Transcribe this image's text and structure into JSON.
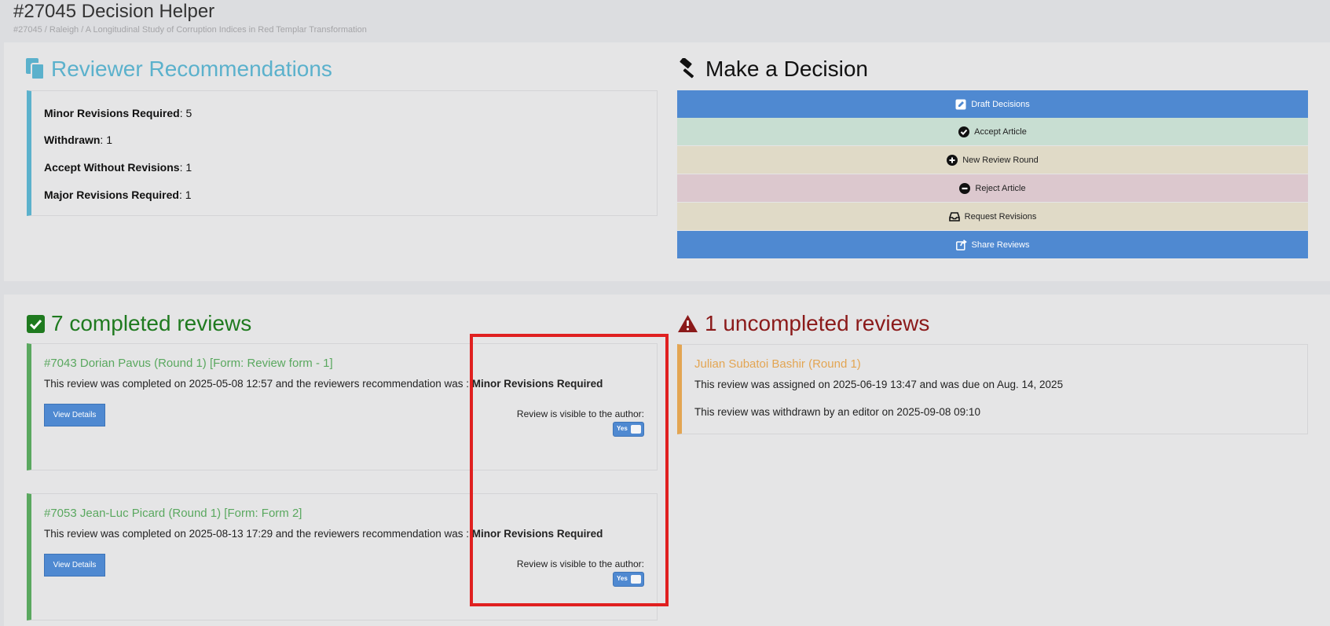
{
  "header": {
    "title": "#27045 Decision Helper",
    "breadcrumb": "#27045 / Raleigh / A Longitudinal Study of Corruption Indices in Red Templar Transformation"
  },
  "recommendations": {
    "title": "Reviewer Recommendations",
    "items": [
      {
        "label": "Minor Revisions Required",
        "value": ": 5"
      },
      {
        "label": "Withdrawn",
        "value": ": 1"
      },
      {
        "label": "Accept Without Revisions",
        "value": ": 1"
      },
      {
        "label": "Major Revisions Required",
        "value": ": 1"
      }
    ]
  },
  "decision": {
    "title": "Make a Decision",
    "buttons": [
      {
        "label": "Draft Decisions",
        "icon": "edit-icon"
      },
      {
        "label": "Accept Article",
        "icon": "check-circle-icon"
      },
      {
        "label": "New Review Round",
        "icon": "plus-circle-icon"
      },
      {
        "label": "Reject Article",
        "icon": "minus-circle-icon"
      },
      {
        "label": "Request Revisions",
        "icon": "inbox-icon"
      },
      {
        "label": "Share Reviews",
        "icon": "share-icon"
      }
    ]
  },
  "completed": {
    "title": "7 completed reviews",
    "reviews": [
      {
        "title": "#7043 Dorian Pavus (Round 1) [Form: Review form - 1]",
        "text": "This review was completed on 2025-05-08 12:57 and the reviewers recommendation was : ",
        "recommendation": "Minor Revisions Required",
        "button": "View Details",
        "visible_label": "Review is visible to the author:",
        "toggle": "Yes"
      },
      {
        "title": "#7053 Jean-Luc Picard (Round 1) [Form: Form 2]",
        "text": "This review was completed on 2025-08-13 17:29 and the reviewers recommendation was : ",
        "recommendation": "Minor Revisions Required",
        "button": "View Details",
        "visible_label": "Review is visible to the author:",
        "toggle": "Yes"
      }
    ]
  },
  "uncompleted": {
    "title": "1 uncompleted reviews",
    "reviews": [
      {
        "title": "Julian Subatoi Bashir (Round 1)",
        "assigned": "This review was assigned on 2025-06-19 13:47 and was due on Aug. 14, 2025",
        "withdrawn": "This review was withdrawn by an editor on 2025-09-08 09:10"
      }
    ]
  },
  "colors": {
    "info": "#5bb1cc",
    "primary": "#4f89d1",
    "success": "#5aa85f",
    "danger": "#8b1a1a",
    "warning": "#e3a552",
    "highlight": "#e02020"
  }
}
